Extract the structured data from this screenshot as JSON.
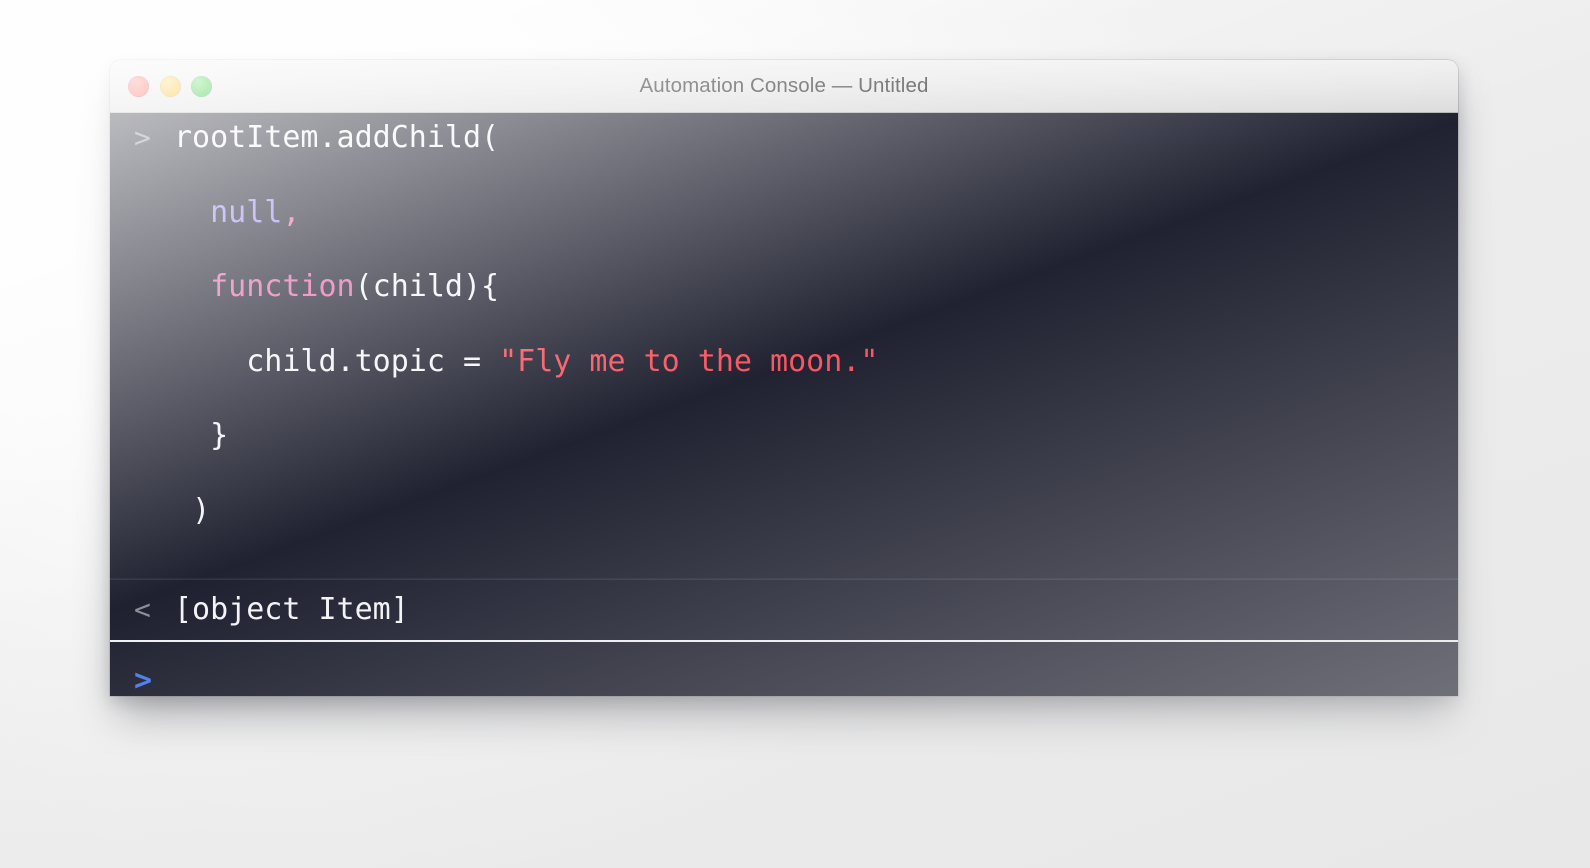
{
  "window": {
    "title": "Automation Console — Untitled",
    "controls": [
      {
        "name": "close",
        "label": "Close",
        "color": "#fb6259"
      },
      {
        "name": "minimize",
        "label": "Minimize",
        "color": "#fbc02f"
      },
      {
        "name": "zoom",
        "label": "Zoom",
        "color": "#2ec938"
      }
    ]
  },
  "theme": {
    "background": "#212231",
    "result_background": "#1f2030",
    "text": "#f4f4f7",
    "prompt_echo": "#8b8d97",
    "prompt_input": "#4a7bec",
    "string": "#f8555f",
    "keyword": "#e86aac",
    "constant": "#9f8cf2",
    "separator": "#f1f1f4",
    "titlebar_text": "#3a3a3c"
  },
  "console": {
    "echo_prompt": ">",
    "result_prompt": "<",
    "input_prompt": ">",
    "command_lines": [
      {
        "prompt": ">",
        "indent": "",
        "tokens": [
          {
            "text": "rootItem.addChild(",
            "kind": "plain"
          }
        ]
      },
      {
        "prompt": "",
        "indent": "  ",
        "tokens": [
          {
            "text": "null",
            "kind": "null"
          },
          {
            "text": ",",
            "kind": "punct"
          }
        ]
      },
      {
        "prompt": "",
        "indent": "  ",
        "tokens": [
          {
            "text": "function",
            "kind": "kw"
          },
          {
            "text": "(child){",
            "kind": "plain"
          }
        ]
      },
      {
        "prompt": "",
        "indent": "    ",
        "tokens": [
          {
            "text": "child.topic = ",
            "kind": "plain"
          },
          {
            "text": "\"Fly me to the moon.\"",
            "kind": "str"
          }
        ]
      },
      {
        "prompt": "",
        "indent": "  ",
        "tokens": [
          {
            "text": "}",
            "kind": "plain"
          }
        ]
      },
      {
        "prompt": "",
        "indent": " ",
        "tokens": [
          {
            "text": ")",
            "kind": "plain"
          }
        ]
      }
    ],
    "result": "[object Item]",
    "input_value": "",
    "input_placeholder": ""
  }
}
